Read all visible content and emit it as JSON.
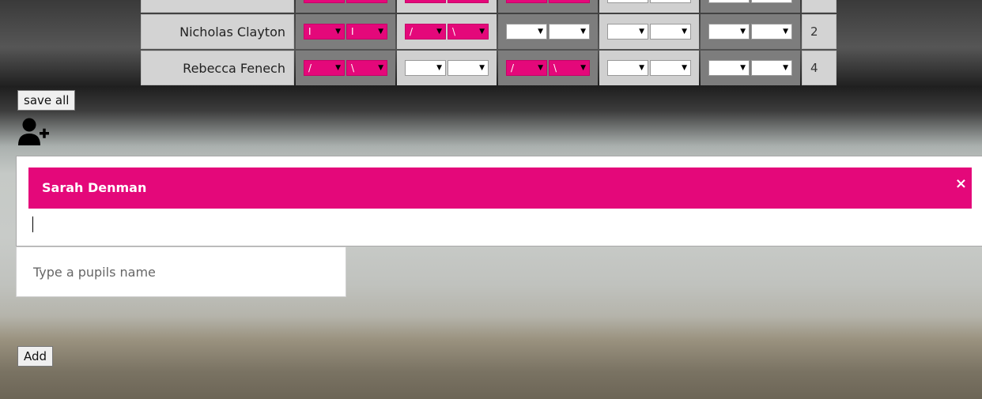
{
  "table": {
    "rows": [
      {
        "name": "",
        "score": "",
        "cells": [
          {
            "shade": "dark",
            "selects": [
              {
                "value": "",
                "color": "pink"
              },
              {
                "value": "",
                "color": "pink"
              }
            ]
          },
          {
            "shade": "light",
            "selects": [
              {
                "value": "",
                "color": "pink"
              },
              {
                "value": "",
                "color": "pink"
              }
            ]
          },
          {
            "shade": "dark",
            "selects": [
              {
                "value": "",
                "color": "pink"
              },
              {
                "value": "",
                "color": "pink"
              }
            ]
          },
          {
            "shade": "light",
            "selects": [
              {
                "value": "",
                "color": "white"
              },
              {
                "value": "",
                "color": "white"
              }
            ]
          },
          {
            "shade": "dark",
            "selects": [
              {
                "value": "",
                "color": "white"
              },
              {
                "value": "",
                "color": "white"
              }
            ]
          }
        ]
      },
      {
        "name": "Nicholas Clayton",
        "score": "2",
        "cells": [
          {
            "shade": "dark",
            "selects": [
              {
                "value": "I",
                "color": "pink"
              },
              {
                "value": "I",
                "color": "pink"
              }
            ]
          },
          {
            "shade": "light",
            "selects": [
              {
                "value": "/",
                "color": "pink"
              },
              {
                "value": "\\",
                "color": "pink"
              }
            ]
          },
          {
            "shade": "dark",
            "selects": [
              {
                "value": "",
                "color": "white"
              },
              {
                "value": "",
                "color": "white"
              }
            ]
          },
          {
            "shade": "light",
            "selects": [
              {
                "value": "",
                "color": "white"
              },
              {
                "value": "",
                "color": "white"
              }
            ]
          },
          {
            "shade": "dark",
            "selects": [
              {
                "value": "",
                "color": "white"
              },
              {
                "value": "",
                "color": "white"
              }
            ]
          }
        ]
      },
      {
        "name": "Rebecca Fenech",
        "score": "4",
        "cells": [
          {
            "shade": "dark",
            "selects": [
              {
                "value": "/",
                "color": "pink"
              },
              {
                "value": "\\",
                "color": "pink"
              }
            ]
          },
          {
            "shade": "light",
            "selects": [
              {
                "value": "",
                "color": "white"
              },
              {
                "value": "",
                "color": "white"
              }
            ]
          },
          {
            "shade": "dark",
            "selects": [
              {
                "value": "/",
                "color": "pink"
              },
              {
                "value": "\\",
                "color": "pink"
              }
            ]
          },
          {
            "shade": "light",
            "selects": [
              {
                "value": "",
                "color": "white"
              },
              {
                "value": "",
                "color": "white"
              }
            ]
          },
          {
            "shade": "dark",
            "selects": [
              {
                "value": "",
                "color": "white"
              },
              {
                "value": "",
                "color": "white"
              }
            ]
          }
        ]
      }
    ]
  },
  "buttons": {
    "save_all": "save all",
    "add": "Add"
  },
  "icons": {
    "add_user": "add-user-icon",
    "chip_close": "close-icon",
    "dropdown_arrow": "chevron-down-icon"
  },
  "tag_input": {
    "chips": [
      {
        "label": "Sarah Denman",
        "close": "×"
      }
    ]
  },
  "suggestion": {
    "hint": "Type a pupils name"
  },
  "colors": {
    "accent": "#e4087a",
    "cell_dark": "#7d7d7d",
    "cell_light": "#d0d0d0",
    "name_cell": "#d3d3d3"
  }
}
